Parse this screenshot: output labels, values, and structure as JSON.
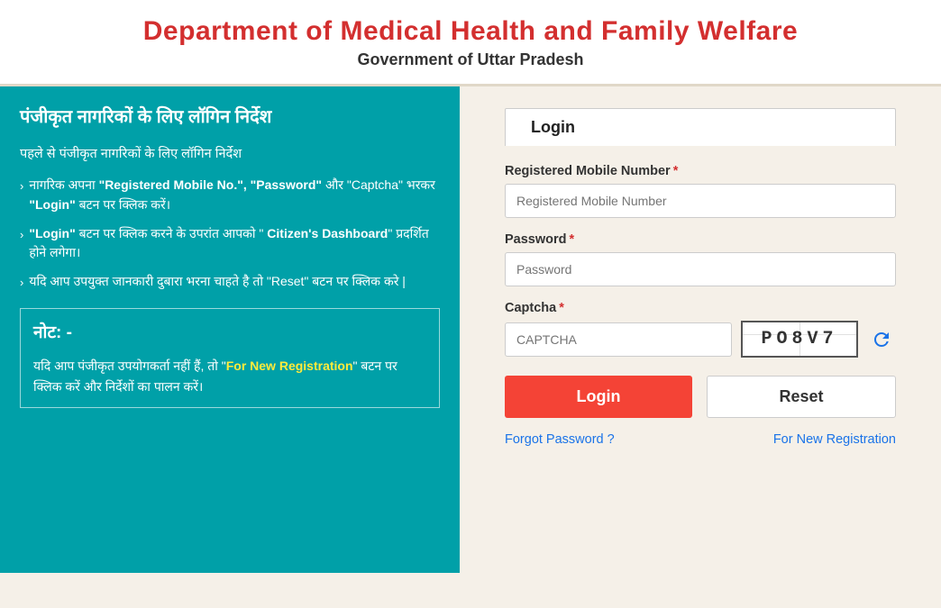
{
  "header": {
    "title": "Department of Medical Health and Family Welfare",
    "subtitle": "Government of Uttar Pradesh"
  },
  "left_panel": {
    "heading": "पंजीकृत नागरिकों के लिए लॉगिन निर्देश",
    "intro": "पहले से पंजीकृत नागरिकों के लिए लॉगिन निर्देश",
    "instructions": [
      {
        "text_before": "नागरिक अपना ",
        "bold": "\"Registered Mobile No.\", \"Password\"",
        "text_after": " और \"Captcha\" भरकर \"Login\" बटन पर क्लिक करें।"
      },
      {
        "text_before": "\"Login\" बटन पर क्लिक करने के उपरांत आपको \" ",
        "bold": "Citizen's Dashboard",
        "text_after": "\" प्रदर्शित होने लगेगा।"
      },
      {
        "text_before": "यदि आप उपयुक्त जानकारी दुबारा भरना चाहते है तो \"Reset\" बटन पर क्लिक करे |"
      }
    ],
    "note_title": "नोट: -",
    "note_text_before": "यदि आप पंजीकृत उपयोगकर्ता नहीं हैं, तो \"",
    "note_highlight": "For New Registration",
    "note_text_after": "\" बटन पर क्लिक करें और निर्देशों का पालन करें।"
  },
  "right_panel": {
    "tab_label": "Login",
    "fields": {
      "mobile_label": "Registered Mobile Number",
      "mobile_placeholder": "Registered Mobile Number",
      "password_label": "Password",
      "password_placeholder": "Password",
      "captcha_label": "Captcha",
      "captcha_placeholder": "CAPTCHA",
      "captcha_value": "PO8V7"
    },
    "buttons": {
      "login": "Login",
      "reset": "Reset"
    },
    "links": {
      "forgot_password": "Forgot Password ?",
      "new_registration": "For New Registration"
    }
  }
}
